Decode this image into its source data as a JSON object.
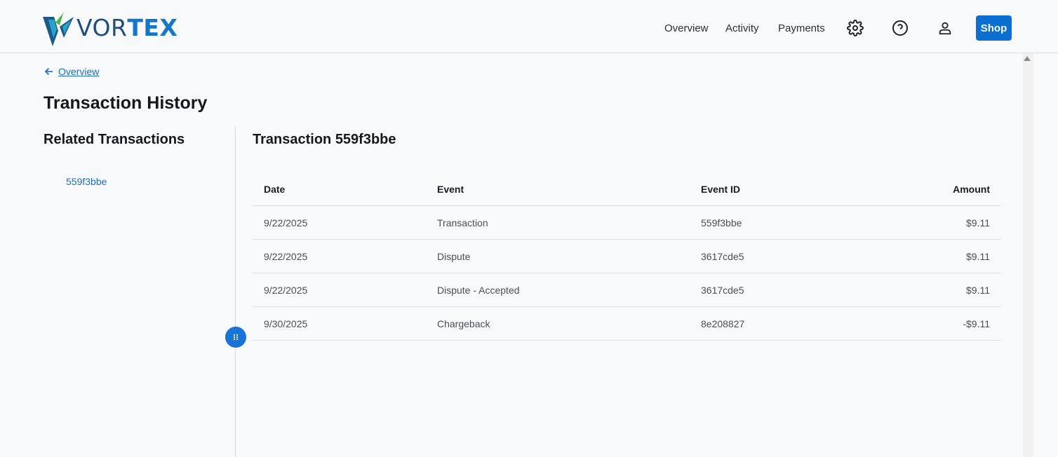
{
  "brand": {
    "name_light": "VOR",
    "name_bold": "TEX",
    "logo_icon": "vortex-logo-icon"
  },
  "nav": {
    "links": [
      "Overview",
      "Activity",
      "Payments"
    ],
    "icons": [
      "gear-icon",
      "help-icon",
      "user-icon"
    ],
    "shop_label": "Shop"
  },
  "breadcrumb": {
    "back_label": "Overview",
    "icon": "arrow-left-icon"
  },
  "page": {
    "title": "Transaction History"
  },
  "related": {
    "title": "Related Transactions",
    "items": [
      "559f3bbe"
    ]
  },
  "transaction": {
    "title": "Transaction 559f3bbe",
    "columns": [
      "Date",
      "Event",
      "Event ID",
      "Amount"
    ],
    "rows": [
      {
        "date": "9/22/2025",
        "event": "Transaction",
        "event_id": "559f3bbe",
        "amount": "$9.11"
      },
      {
        "date": "9/22/2025",
        "event": "Dispute",
        "event_id": "3617cde5",
        "amount": "$9.11"
      },
      {
        "date": "9/22/2025",
        "event": "Dispute - Accepted",
        "event_id": "3617cde5",
        "amount": "$9.11"
      },
      {
        "date": "9/30/2025",
        "event": "Chargeback",
        "event_id": "8e208827",
        "amount": "-$9.11"
      }
    ]
  },
  "colors": {
    "accent": "#0a6fd1",
    "link": "#1a6fc4",
    "background": "#f8f9fb"
  }
}
